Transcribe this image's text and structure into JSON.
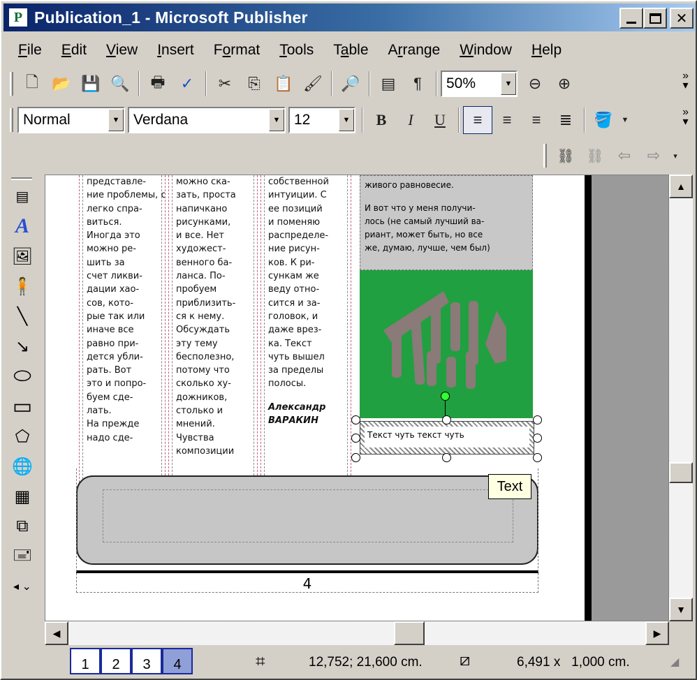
{
  "window": {
    "title": "Publication_1 - Microsoft Publisher",
    "icon": "publisher-icon",
    "title_color": "#0a246a"
  },
  "caption_buttons": [
    "minimize-icon",
    "maximize-icon",
    "close-icon"
  ],
  "menu": [
    {
      "pre": "",
      "u": "F",
      "post": "ile"
    },
    {
      "pre": "",
      "u": "E",
      "post": "dit"
    },
    {
      "pre": "",
      "u": "V",
      "post": "iew"
    },
    {
      "pre": "",
      "u": "I",
      "post": "nsert"
    },
    {
      "pre": "F",
      "u": "o",
      "post": "rmat"
    },
    {
      "pre": "",
      "u": "T",
      "post": "ools"
    },
    {
      "pre": "T",
      "u": "a",
      "post": "ble"
    },
    {
      "pre": "A",
      "u": "r",
      "post": "range"
    },
    {
      "pre": "",
      "u": "W",
      "post": "indow"
    },
    {
      "pre": "",
      "u": "H",
      "post": "elp"
    }
  ],
  "standard_toolbar": {
    "zoom": "50%"
  },
  "format_toolbar": {
    "style": "Normal",
    "font": "Verdana",
    "size": "12",
    "bold": "B",
    "italic": "I",
    "underline": "U"
  },
  "columns": [
    {
      "lines": [
        "представле-",
        "ние проблемы, с ней",
        "легко спра-",
        "виться.",
        "Иногда это",
        "можно ре-",
        "шить за",
        "счет ликви-",
        "дации хао-",
        "сов, кото-",
        "рые так или",
        "иначе все",
        "равно при-",
        "дется убли-",
        "рать. Вот",
        "это и попро-",
        "буем сде-",
        "лать.",
        "На прежде",
        "надо сде-"
      ]
    },
    {
      "lines": [
        "можно ска-",
        "зать, проста",
        "напичкано",
        "рисунками,",
        "и все. Нет",
        "художест-",
        "венного ба-",
        "ланса. По-",
        "пробуем",
        "приблизить-",
        "ся к нему.",
        "Обсуждать",
        "эту тему",
        "бесполезно,",
        "потому что",
        "сколько ху-",
        "дожников,",
        "столько и",
        "мнений.",
        "Чувства",
        "композиции"
      ]
    },
    {
      "lines": [
        "собственной",
        "интуиции. С",
        "ее позиций",
        "и поменяю",
        "распределе-",
        "ние рисун-",
        "ков. К ри-",
        "сункам же",
        "веду отно-",
        "сится и за-",
        "головок, и",
        "даже врез-",
        "ка. Текст",
        "чуть вышел",
        "за пределы",
        "полосы."
      ],
      "author": "Александр\nВАРАКИН"
    }
  ],
  "sidebar_box": {
    "line1": "живого равновесие.",
    "line2": "И вот что у меня получи-\nлось (не самый лучший ва-\nриант, может быть, но все\nже, думаю, лучше, чем был)"
  },
  "caption_text": "Текст чуть текст чуть",
  "tooltip": "Text",
  "page_number": "4",
  "pages": [
    "1",
    "2",
    "3",
    "4"
  ],
  "active_page": "4",
  "status": {
    "position": "12,752; 21,600 cm.",
    "size": "6,491 x   1,000 cm."
  },
  "colors": {
    "image_green": "#20a040",
    "image_gray": "#8a7a78"
  }
}
